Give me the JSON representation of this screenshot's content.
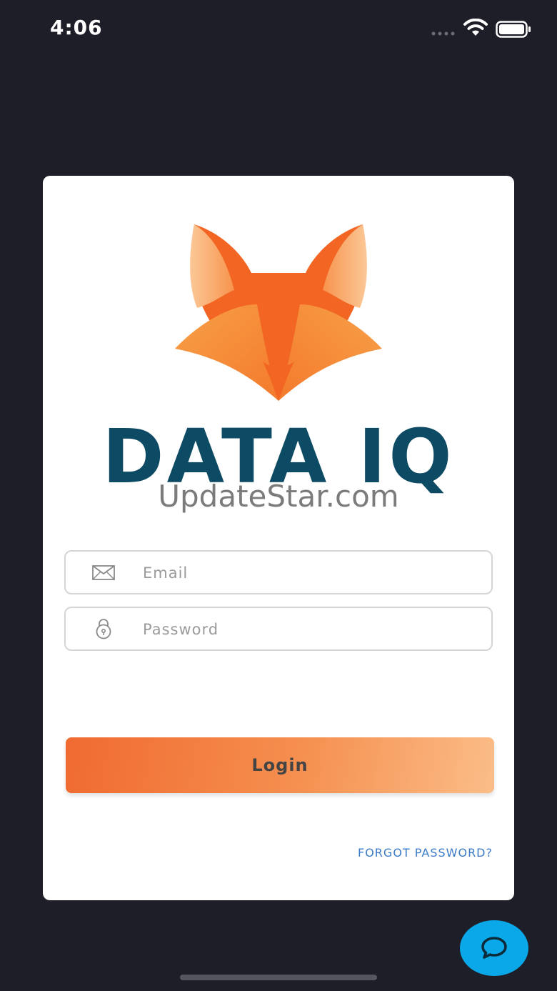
{
  "status_bar": {
    "time": "4:06"
  },
  "brand": {
    "name": "DATA IQ",
    "primary_color": "#0d4a63",
    "accent_color": "#f26522"
  },
  "watermark": "UpdateStar.com",
  "login_form": {
    "email_placeholder": "Email",
    "email_icon": "envelope-icon",
    "password_placeholder": "Password",
    "password_icon": "lock-icon",
    "login_label": "Login",
    "forgot_password_label": "FORGOT PASSWORD?"
  },
  "chat": {
    "icon": "chat-bubble-icon",
    "color": "#0aa8e8"
  }
}
